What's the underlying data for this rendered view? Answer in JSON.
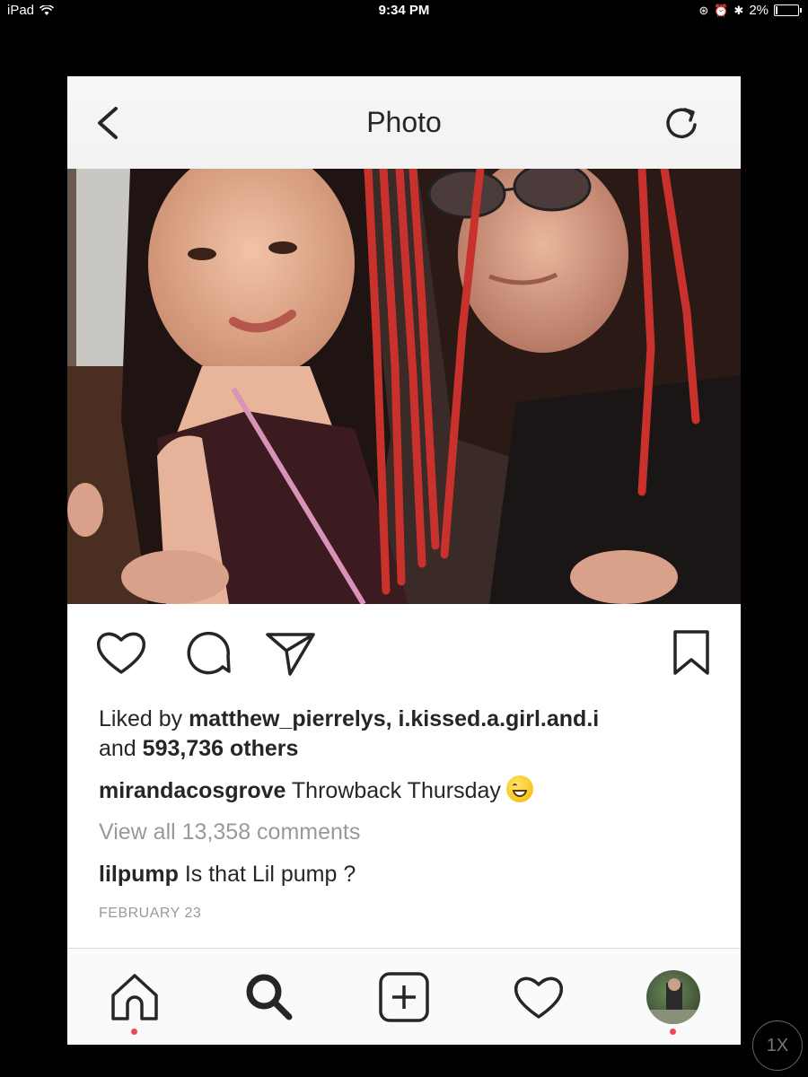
{
  "status_bar": {
    "device": "iPad",
    "time": "9:34 PM",
    "battery": "2%"
  },
  "nav": {
    "title": "Photo"
  },
  "post": {
    "liked_prefix": "Liked by ",
    "liked_user1": "matthew_pierrelys",
    "liked_sep": ", ",
    "liked_user2": "i.kissed.a.girl.and.i",
    "and_word": "and ",
    "others_count": "593,736 others",
    "author": "mirandacosgrove",
    "caption_text": " Throwback Thursday",
    "caption_emoji": "grinning-face-emoji",
    "view_all": "View all 13,358 comments",
    "comment_user": "lilpump",
    "comment_text": " Is that Lil pump ?",
    "date": "FEBRUARY 23"
  },
  "zoom": "1X",
  "colors": {
    "notification_dot": "#ed4956",
    "text": "#262626",
    "muted": "#999999"
  }
}
